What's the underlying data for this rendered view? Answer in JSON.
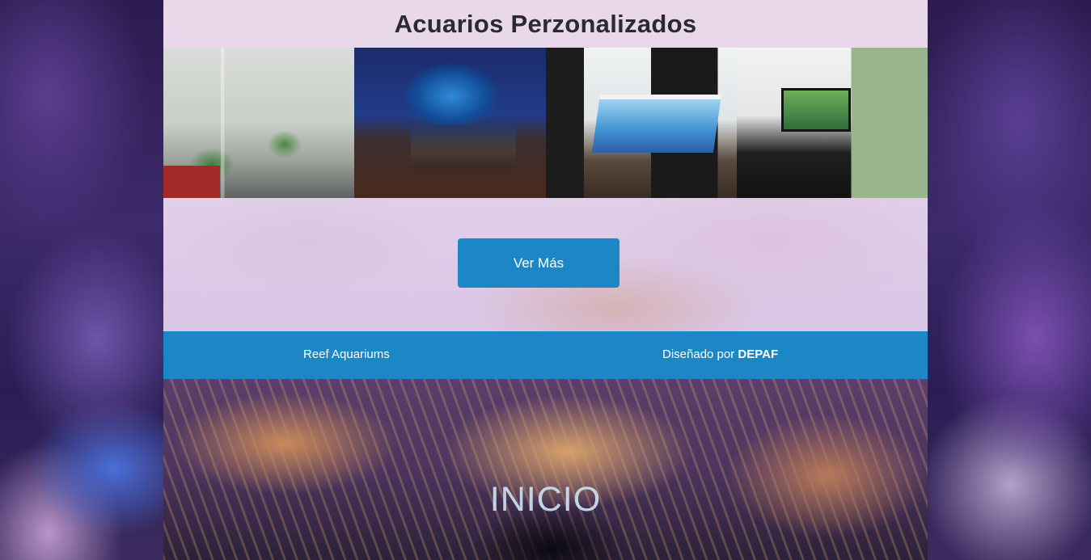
{
  "section": {
    "title": "Acuarios Perzonalizados"
  },
  "gallery": {
    "photos": [
      {
        "name": "stair-aquarium-photo"
      },
      {
        "name": "bedroom-aquarium-photo"
      },
      {
        "name": "kitchen-island-aquarium-photo"
      },
      {
        "name": "office-aquarium-photo"
      }
    ]
  },
  "cta": {
    "label": "Ver Más"
  },
  "footer": {
    "brand": "Reef Aquariums",
    "credit_prefix": "Diseñado por",
    "credit_name": "DEPAF"
  },
  "hero": {
    "title": "INICIO"
  },
  "colors": {
    "accent": "#1c87c5",
    "title_text": "#2a2a33",
    "button_text": "#ffffff"
  }
}
